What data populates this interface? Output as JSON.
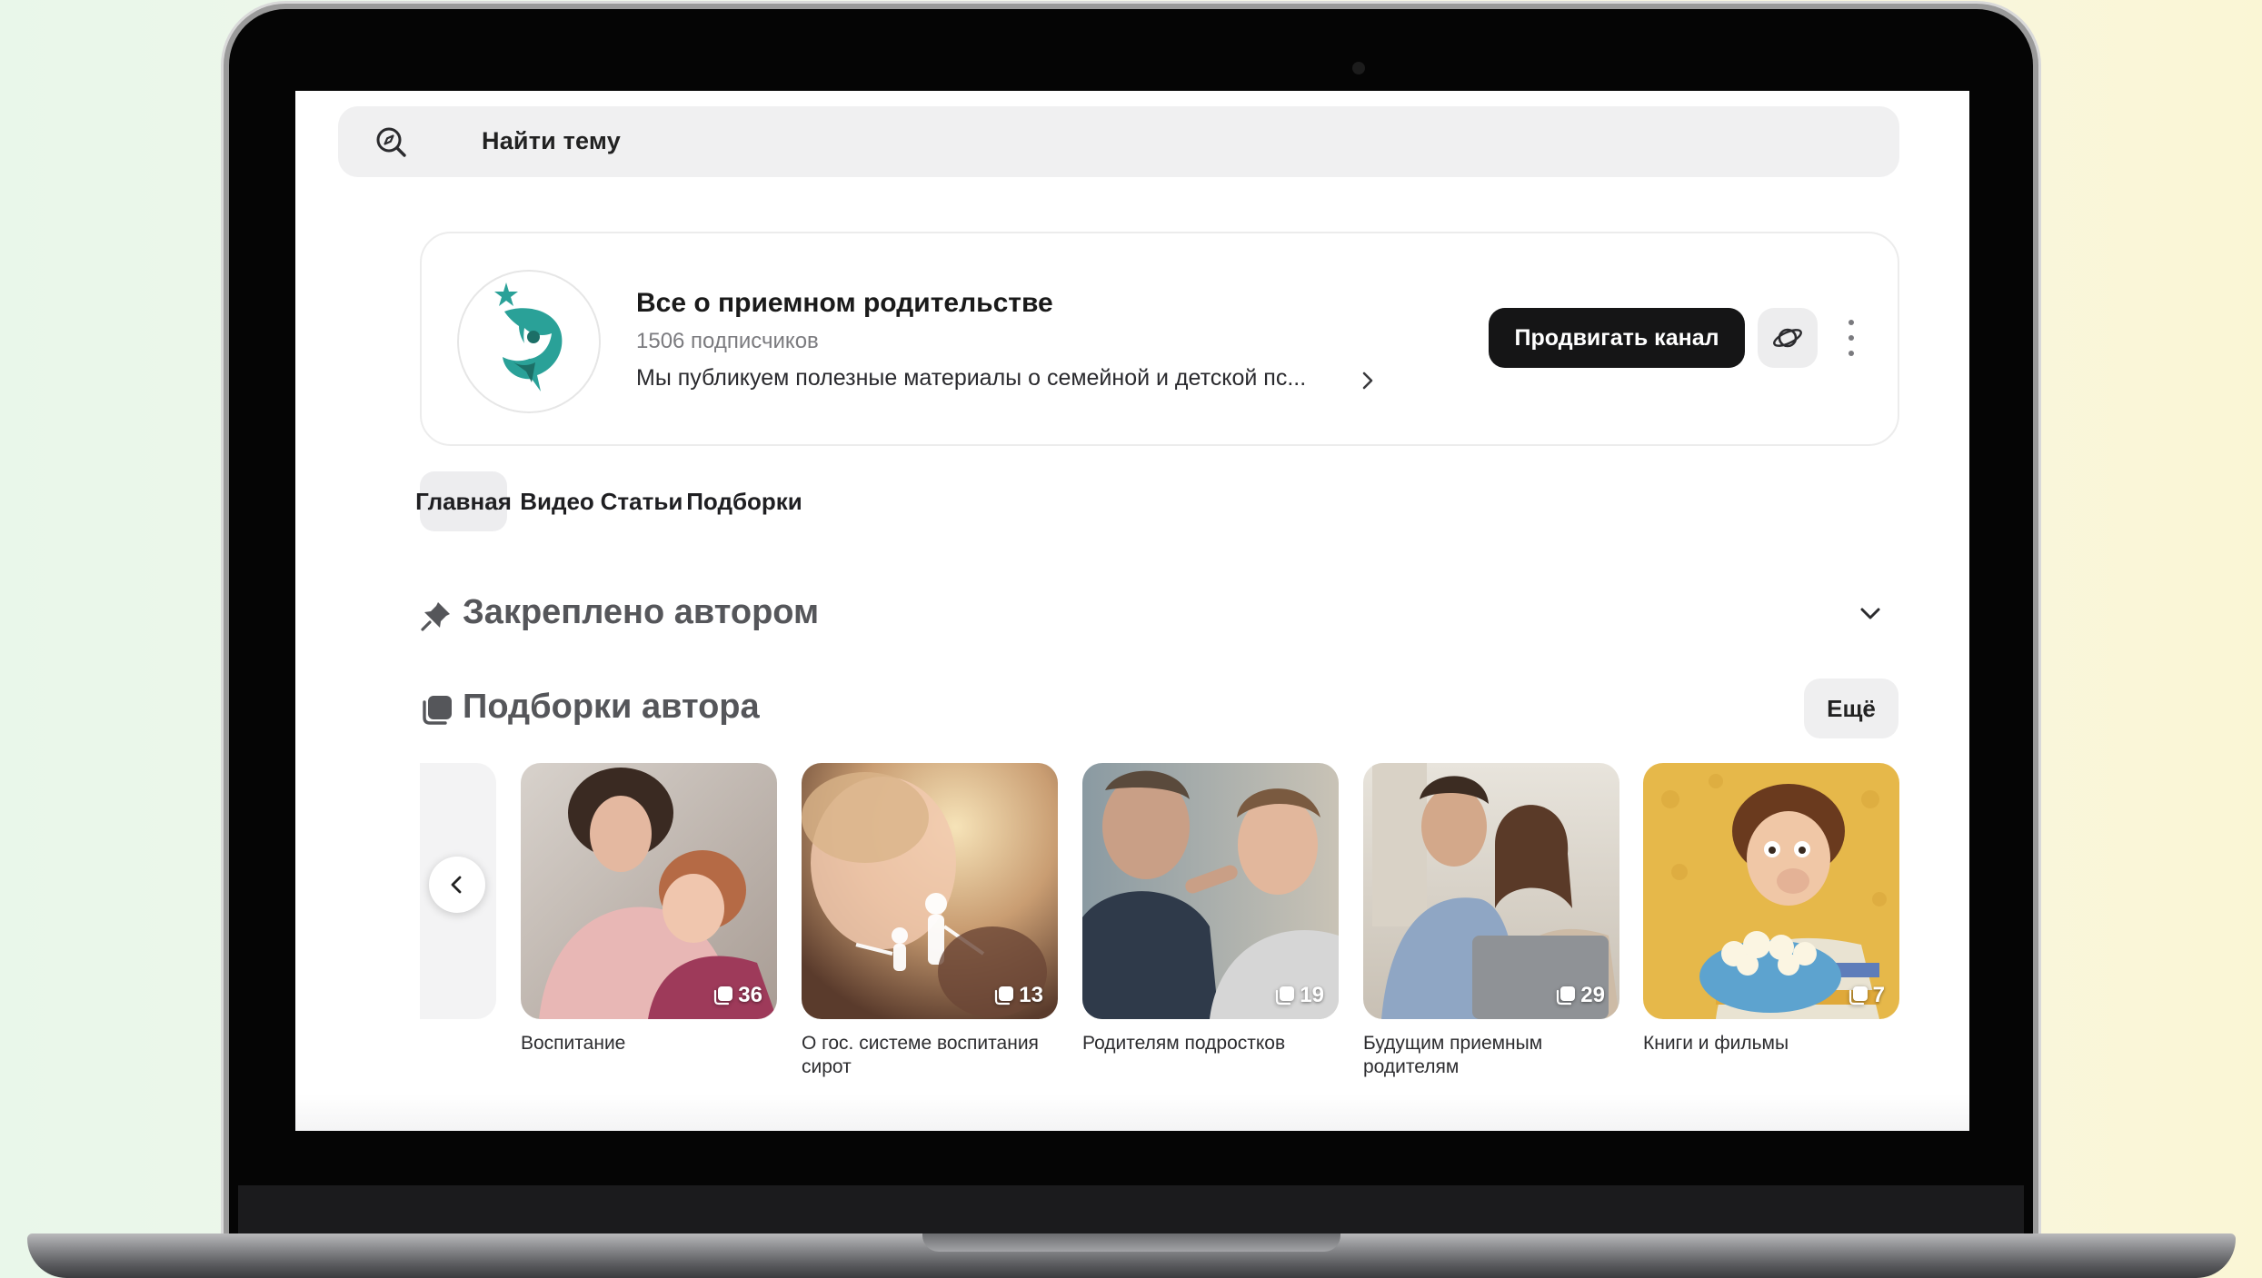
{
  "search": {
    "placeholder": "Найти тему"
  },
  "channel": {
    "title": "Все о приемном родительстве",
    "subscribers": "1506 подписчиков",
    "description": "Мы публикуем полезные материалы о семейной и детской пс...",
    "promote_label": "Продвигать канал",
    "colors": {
      "logo_teal": "#2aa198",
      "logo_dark": "#1c6f67"
    }
  },
  "tabs": [
    {
      "label": "Главная",
      "active": true
    },
    {
      "label": "Видео",
      "active": false
    },
    {
      "label": "Статьи",
      "active": false
    },
    {
      "label": "Подборки",
      "active": false
    }
  ],
  "pinned": {
    "title": "Закреплено автором"
  },
  "collections": {
    "title": "Подборки автора",
    "more_label": "Ещё",
    "items": [
      {
        "label": "Воспитание",
        "count": "36"
      },
      {
        "label": "О гос. системе воспитания сирот",
        "count": "13"
      },
      {
        "label": "Родителям подростков",
        "count": "19"
      },
      {
        "label": "Будущим приемным родителям",
        "count": "29"
      },
      {
        "label": "Книги и фильмы",
        "count": "7"
      }
    ]
  },
  "icons": {
    "search": "search-compass-icon",
    "planet": "planet-icon",
    "more": "more-vertical-icon",
    "pin": "pin-icon",
    "collection": "collection-stack-icon",
    "collapse": "chevron-down-icon",
    "prev": "chevron-left-icon"
  }
}
